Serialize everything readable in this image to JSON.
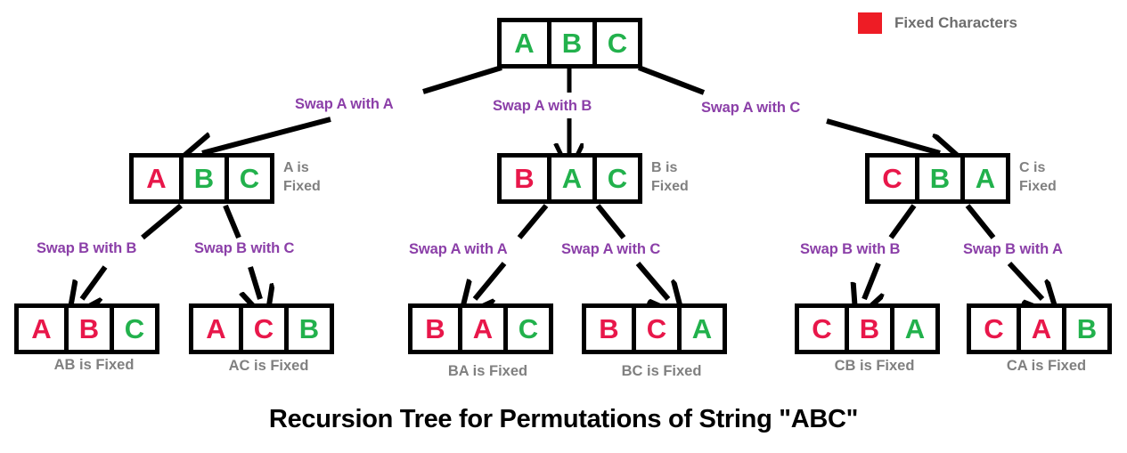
{
  "title": "Recursion Tree for Permutations of String \"ABC\"",
  "colors": {
    "fixed": "#e8174a",
    "free": "#22b14c",
    "edge_label": "#8b3fa8",
    "side_label": "#808080",
    "legend_swatch": "#ee1c25",
    "box_border": "#000000",
    "background": "#ffffff"
  },
  "legend": {
    "swatch_color": "#ee1c25",
    "label": "Fixed Characters",
    "swatch_icon": "red-square-icon"
  },
  "tree": {
    "root": {
      "cells": [
        {
          "char": "A",
          "state": "free"
        },
        {
          "char": "B",
          "state": "free"
        },
        {
          "char": "C",
          "state": "free"
        }
      ],
      "side_label": ""
    },
    "level1": [
      {
        "cells": [
          {
            "char": "A",
            "state": "fixed"
          },
          {
            "char": "B",
            "state": "free"
          },
          {
            "char": "C",
            "state": "free"
          }
        ],
        "side_label": "A is\nFixed",
        "edge_label": "Swap A with A"
      },
      {
        "cells": [
          {
            "char": "B",
            "state": "fixed"
          },
          {
            "char": "A",
            "state": "free"
          },
          {
            "char": "C",
            "state": "free"
          }
        ],
        "side_label": "B is\nFixed",
        "edge_label": "Swap A with B"
      },
      {
        "cells": [
          {
            "char": "C",
            "state": "fixed"
          },
          {
            "char": "B",
            "state": "free"
          },
          {
            "char": "A",
            "state": "free"
          }
        ],
        "side_label": "C is\nFixed",
        "edge_label": "Swap A with C"
      }
    ],
    "level2": [
      {
        "cells": [
          {
            "char": "A",
            "state": "fixed"
          },
          {
            "char": "B",
            "state": "fixed"
          },
          {
            "char": "C",
            "state": "free"
          }
        ],
        "under_label": "AB is Fixed",
        "edge_label": "Swap B with B"
      },
      {
        "cells": [
          {
            "char": "A",
            "state": "fixed"
          },
          {
            "char": "C",
            "state": "fixed"
          },
          {
            "char": "B",
            "state": "free"
          }
        ],
        "under_label": "AC is Fixed",
        "edge_label": "Swap B with C"
      },
      {
        "cells": [
          {
            "char": "B",
            "state": "fixed"
          },
          {
            "char": "A",
            "state": "fixed"
          },
          {
            "char": "C",
            "state": "free"
          }
        ],
        "under_label": "BA is Fixed",
        "edge_label": "Swap A with A"
      },
      {
        "cells": [
          {
            "char": "B",
            "state": "fixed"
          },
          {
            "char": "C",
            "state": "fixed"
          },
          {
            "char": "A",
            "state": "free"
          }
        ],
        "under_label": "BC is Fixed",
        "edge_label": "Swap A with C"
      },
      {
        "cells": [
          {
            "char": "C",
            "state": "fixed"
          },
          {
            "char": "B",
            "state": "fixed"
          },
          {
            "char": "A",
            "state": "free"
          }
        ],
        "under_label": "CB is Fixed",
        "edge_label": "Swap B with B"
      },
      {
        "cells": [
          {
            "char": "C",
            "state": "fixed"
          },
          {
            "char": "A",
            "state": "fixed"
          },
          {
            "char": "B",
            "state": "free"
          }
        ],
        "under_label": "CA is Fixed",
        "edge_label": "Swap B with A"
      }
    ]
  }
}
